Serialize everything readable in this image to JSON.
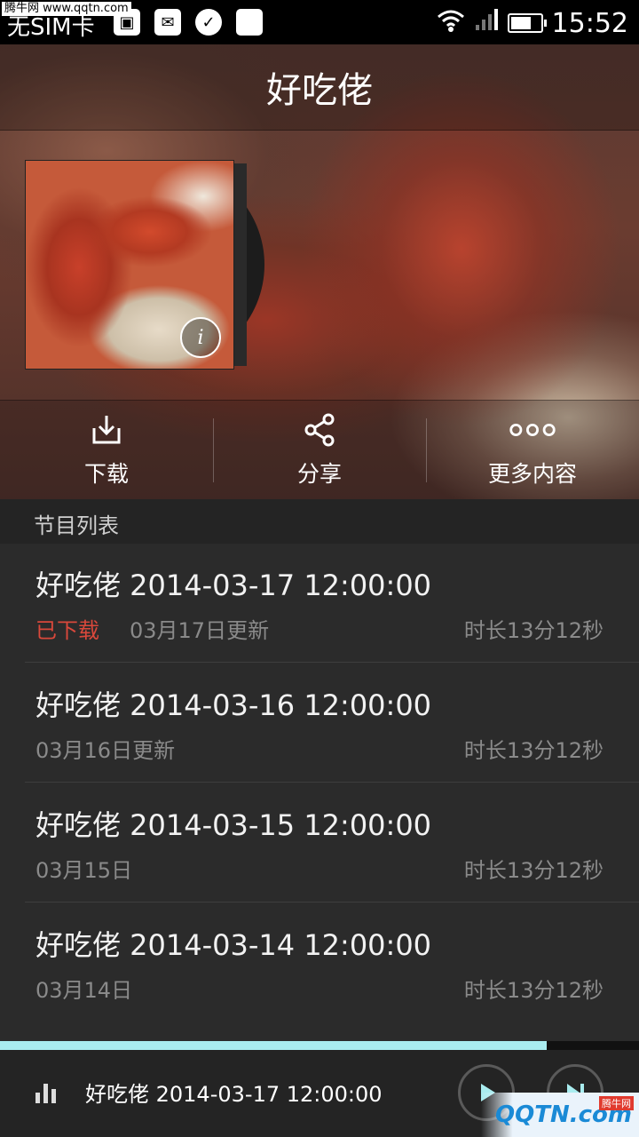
{
  "status_bar": {
    "watermark": "腾牛网 www.qqtn.com",
    "carrier": "无SIM卡",
    "time": "15:52"
  },
  "header": {
    "title": "好吃佬"
  },
  "actions": [
    {
      "label": "下载",
      "icon": "download-icon"
    },
    {
      "label": "分享",
      "icon": "share-icon"
    },
    {
      "label": "更多内容",
      "icon": "more-icon"
    }
  ],
  "list": {
    "header": "节目列表",
    "items": [
      {
        "title": "好吃佬 2014-03-17 12:00:00",
        "status": "已下载",
        "updated": "03月17日更新",
        "duration": "时长13分12秒"
      },
      {
        "title": "好吃佬 2014-03-16 12:00:00",
        "status": "",
        "updated": "03月16日更新",
        "duration": "时长13分12秒"
      },
      {
        "title": "好吃佬 2014-03-15 12:00:00",
        "status": "",
        "updated": "03月15日",
        "duration": "时长13分12秒"
      },
      {
        "title": "好吃佬 2014-03-14 12:00:00",
        "status": "",
        "updated": "03月14日",
        "duration": "时长13分12秒"
      }
    ]
  },
  "player": {
    "now_playing": "好吃佬 2014-03-17 12:00:00",
    "progress": 0.855
  },
  "watermark_br": {
    "text": "QQTN.com",
    "badge": "腾牛网"
  },
  "colors": {
    "accent_red": "#d9483b",
    "progress": "#a9ecef",
    "background": "#2b2b2b"
  }
}
